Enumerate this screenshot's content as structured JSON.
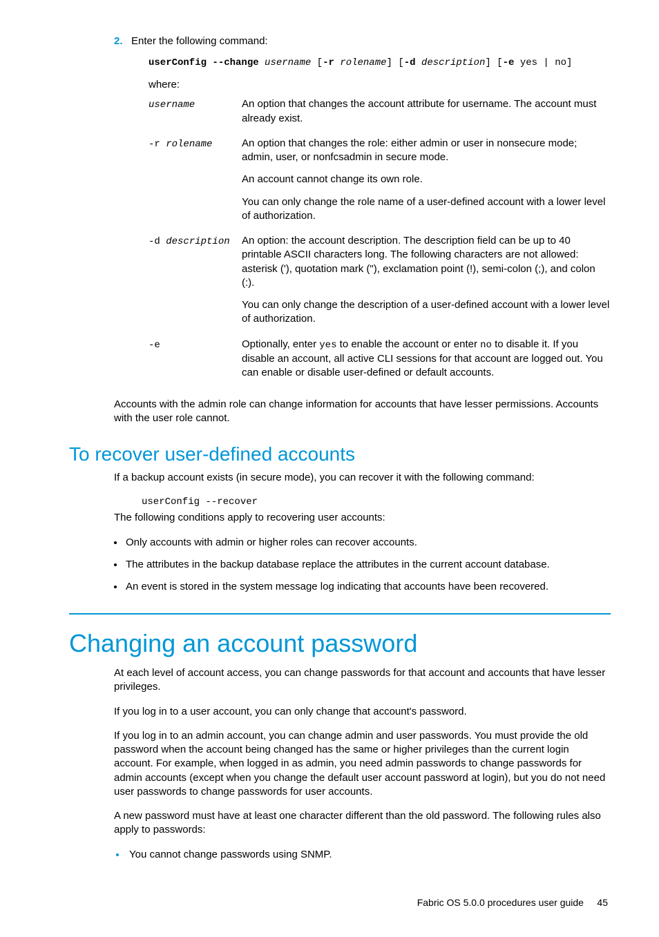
{
  "step": {
    "number": "2.",
    "text": "Enter the following command:"
  },
  "command": {
    "cmd": "userConfig --change",
    "arg1": "username",
    "opt_r": "-r",
    "arg_r": "rolename",
    "opt_d": "-d",
    "arg_d": "description",
    "opt_e": "-e",
    "arg_e": "yes | no",
    "br_open": "[",
    "br_close": "]"
  },
  "where_label": "where:",
  "defs": {
    "username": {
      "term": "username",
      "p1": "An option that changes the account attribute for username. The account must already exist."
    },
    "rolename": {
      "term_pre": "-r ",
      "term": "rolename",
      "p1": "An option that changes the role: either admin or user in nonsecure mode; admin, user, or nonfcsadmin in secure mode.",
      "p2": "An account cannot change its own role.",
      "p3": "You can only change the role name of a user-defined account with a lower level of authorization."
    },
    "description": {
      "term_pre": "-d ",
      "term": "description",
      "p1": "An option: the account description. The description field can be up to 40 printable ASCII characters long. The following characters are not allowed: asterisk ('), quotation mark (\"), exclamation point (!), semi-colon (;), and colon (:).",
      "p2": "You can only change the description of a user-defined account with a lower level of authorization."
    },
    "e": {
      "term": "-e",
      "pre": "Optionally, enter ",
      "yes": "yes",
      "mid": " to enable the account or enter ",
      "no": "no",
      "post": " to disable it. If you disable an account, all active CLI sessions for that account are logged out. You can enable or disable user-defined or default accounts."
    }
  },
  "after_table": "Accounts with the admin role can change information for accounts that have lesser permissions. Accounts with the user role cannot.",
  "recover": {
    "heading": "To recover user-defined accounts",
    "intro": "If a backup account exists (in secure mode), you can recover it with the following command:",
    "cmd": "userConfig --recover",
    "cond_intro": "The following conditions apply to recovering user accounts:",
    "bullets": [
      "Only accounts with admin or higher roles can recover accounts.",
      "The attributes in the backup database replace the attributes in the current account database.",
      "An event is stored in the system message log indicating that accounts have been recovered."
    ]
  },
  "changing": {
    "heading": "Changing an account password",
    "p1": "At each level of account access, you can change passwords for that account and accounts that have lesser privileges.",
    "p2": "If you log in to a user account, you can only change that account's password.",
    "p3": "If you log in to an admin account, you can change admin and user passwords. You must provide the old password when the account being changed has the same or higher privileges than the current login account. For example, when logged in as admin, you need admin passwords to change passwords for admin accounts (except when you change the default user account password at login), but you do not need user passwords to change passwords for user accounts.",
    "p4": "A new password must have at least one character different than the old password. The following rules also apply to passwords:",
    "bullets": [
      "You cannot change passwords using SNMP."
    ]
  },
  "footer": {
    "title": "Fabric OS 5.0.0 procedures user guide",
    "page": "45"
  }
}
